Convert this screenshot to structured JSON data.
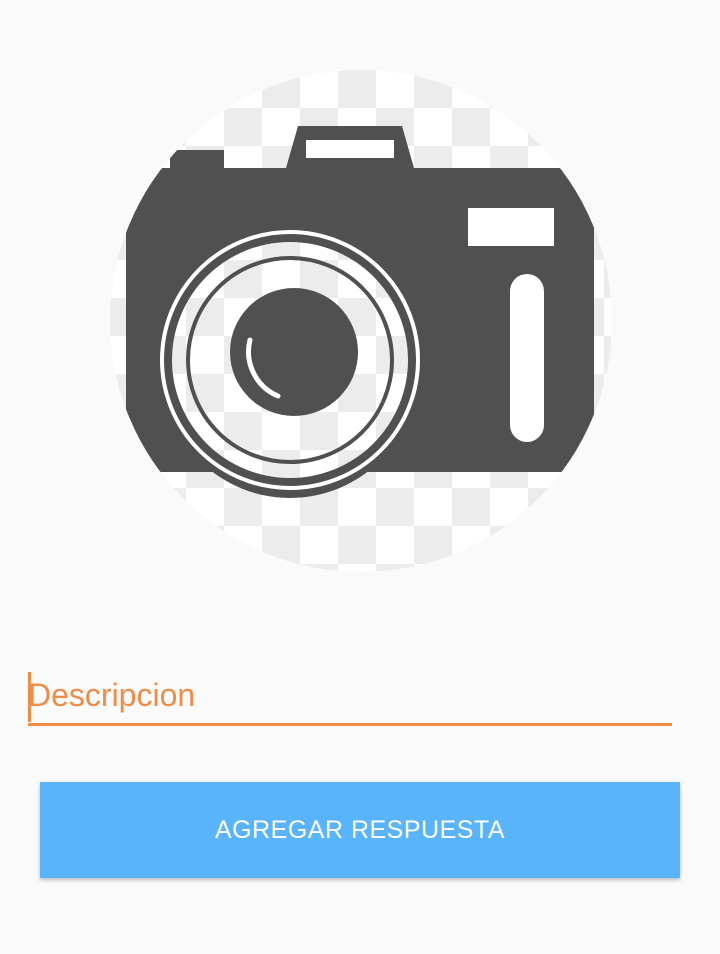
{
  "photo": {
    "icon": "camera-placeholder-icon",
    "colors": {
      "camera_body": "#505050",
      "checker_light": "#ffffff",
      "checker_dark": "#ececec"
    }
  },
  "description": {
    "placeholder": "Descripcion",
    "value": "",
    "accent_color": "#ef8c47"
  },
  "submit": {
    "label": "AGREGAR RESPUESTA",
    "color": "#5ab4fc"
  }
}
